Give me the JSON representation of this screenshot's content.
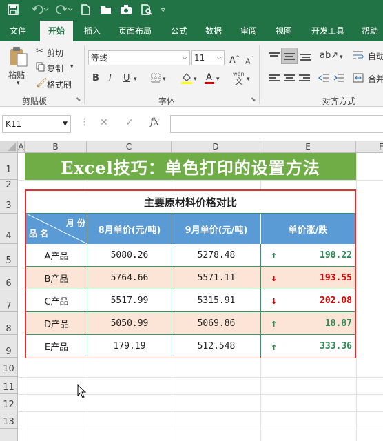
{
  "qat": {
    "save_icon": "save-icon",
    "undo_icon": "undo-icon",
    "redo_icon": "redo-icon",
    "new_icon": "new-file-icon",
    "open_icon": "open-folder-icon",
    "camera_icon": "camera-icon",
    "preview_icon": "print-preview-icon",
    "more_icon": "customize-qat-icon"
  },
  "tabs": [
    "文件",
    "开始",
    "插入",
    "页面布局",
    "公式",
    "数据",
    "审阅",
    "视图",
    "开发工具",
    "帮助"
  ],
  "active_tab": "开始",
  "ribbon": {
    "clipboard": {
      "paste": "粘贴",
      "cut": "剪切",
      "copy": "复制",
      "format_painter": "格式刷",
      "group": "剪贴板"
    },
    "font": {
      "name": "等线",
      "size": "11",
      "bold": "B",
      "italic": "I",
      "underline": "U",
      "grow": "A",
      "shrink": "A",
      "phonetic_top": "wén",
      "phonetic_bottom": "文",
      "group": "字体"
    },
    "alignment": {
      "wrap": "自动",
      "merge": "合并",
      "group": "对齐方式"
    }
  },
  "formula_bar": {
    "name_box": "K11",
    "cancel": "✕",
    "enter": "✓",
    "fx": "fx",
    "formula": ""
  },
  "columns": [
    "A",
    "B",
    "C",
    "D",
    "E",
    "F"
  ],
  "rows": [
    "1",
    "2",
    "3",
    "4",
    "5",
    "6",
    "7",
    "8",
    "9",
    "10",
    "11",
    "12",
    "13"
  ],
  "banner": "Excel技巧：单色打印的设置方法",
  "table": {
    "title": "主要原材料价格对比",
    "corner_top": "月 份",
    "corner_bottom": "品 名",
    "headers": [
      "8月单价(元/吨)",
      "9月单价(元/吨)",
      "单价涨/跌"
    ],
    "rows": [
      {
        "name": "A产品",
        "aug": "5080.26",
        "sep": "5278.48",
        "arrow": "↑",
        "change": "198.22",
        "dir": "up"
      },
      {
        "name": "B产品",
        "aug": "5764.66",
        "sep": "5571.11",
        "arrow": "↓",
        "change": "193.55",
        "dir": "down"
      },
      {
        "name": "C产品",
        "aug": "5517.99",
        "sep": "5315.91",
        "arrow": "↓",
        "change": "202.08",
        "dir": "down"
      },
      {
        "name": "D产品",
        "aug": "5050.99",
        "sep": "5069.86",
        "arrow": "↑",
        "change": "18.87",
        "dir": "up"
      },
      {
        "name": "E产品",
        "aug": "179.19",
        "sep": "512.548",
        "arrow": "↑",
        "change": "333.36",
        "dir": "up"
      }
    ]
  },
  "colors": {
    "excel_green": "#217346",
    "banner_green": "#70ad47",
    "header_blue": "#5b9bd5",
    "pink_fill": "#fce4d6",
    "up_green": "#2e8b57",
    "down_red": "#e00000",
    "border_red": "#e03030",
    "border_green": "#2e9b6a"
  }
}
